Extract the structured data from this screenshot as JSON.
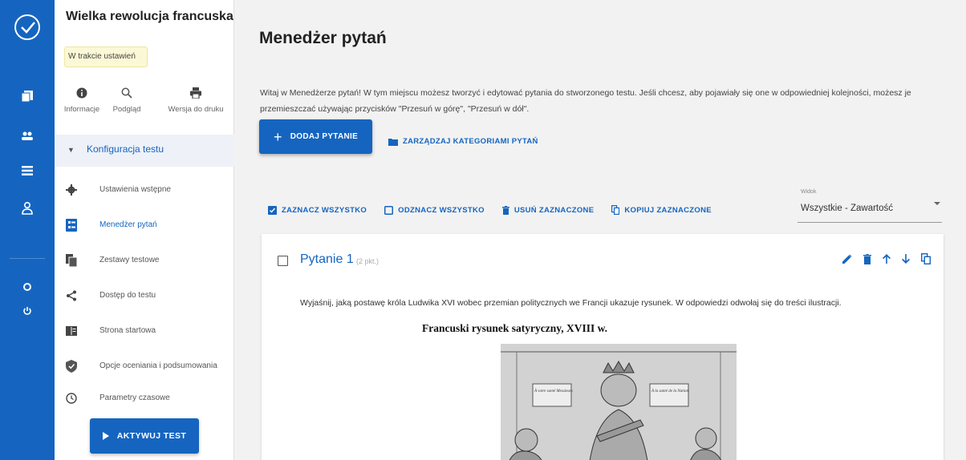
{
  "sidebar": {
    "title": "Wielka rewolucja francuska",
    "status_badge": "W trakcie ustawień",
    "actions": [
      {
        "label": "Informacje",
        "icon": "info-icon"
      },
      {
        "label": "Podgląd",
        "icon": "search-icon"
      },
      {
        "label": "Wersja do druku",
        "icon": "print-icon"
      }
    ],
    "section_label": "Konfiguracja testu",
    "items": [
      {
        "label": "Ustawienia wstępne",
        "icon": "gear-icon"
      },
      {
        "label": "Menedżer pytań",
        "icon": "question-list-icon",
        "active": true
      },
      {
        "label": "Zestawy testowe",
        "icon": "copy-icon"
      },
      {
        "label": "Dostęp do testu",
        "icon": "share-icon"
      },
      {
        "label": "Strona startowa",
        "icon": "book-icon"
      },
      {
        "label": "Opcje oceniania i podsumowania",
        "icon": "shield-icon"
      },
      {
        "label": "Parametry czasowe",
        "icon": "clock-icon"
      }
    ],
    "activate_label": "AKTYWUJ TEST"
  },
  "rail": {
    "icons": [
      "logo-icon",
      "tests-icon",
      "groups-icon",
      "list-icon",
      "user-icon",
      "settings-icon",
      "power-icon"
    ]
  },
  "main": {
    "title": "Menedżer pytań",
    "intro": "Witaj w Menedżerze pytań! W tym miejscu możesz tworzyć i edytować pytania do stworzonego testu. Jeśli chcesz, aby pojawiały się one w odpowiedniej kolejności, możesz je przemieszczać używając przycisków \"Przesuń w górę\", \"Przesuń w dół\".",
    "add_question_label": "DODAJ PYTANIE",
    "manage_categories_label": "ZARZĄDZAJ KATEGORIAMI PYTAŃ",
    "toolbar": {
      "select_all": "ZAZNACZ WSZYSTKO",
      "deselect_all": "ODZNACZ WSZYSTKO",
      "delete_selected": "USUŃ ZAZNACZONE",
      "copy_selected": "KOPIUJ ZAZNACZONE"
    },
    "view_select": {
      "label": "Widok",
      "value": "Wszystkie - Zawartość"
    },
    "question": {
      "title": "Pytanie 1",
      "points": "(2 pkt.)",
      "text": "Wyjaśnij, jaką postawę króla Ludwika XVI wobec przemian politycznych we Francji ukazuje rysunek. W odpowiedzi odwołaj się do treści ilustracji.",
      "figure_title": "Francuski rysunek satyryczny, XVIII w.",
      "figure_caption_left": "À votre santé Messieurs",
      "figure_caption_right": "À la santé de la Nation"
    }
  },
  "colors": {
    "primary": "#1565c0",
    "rail": "#1565c0",
    "badge_bg": "#fbf8d6",
    "section_bg": "#eef1f8"
  }
}
